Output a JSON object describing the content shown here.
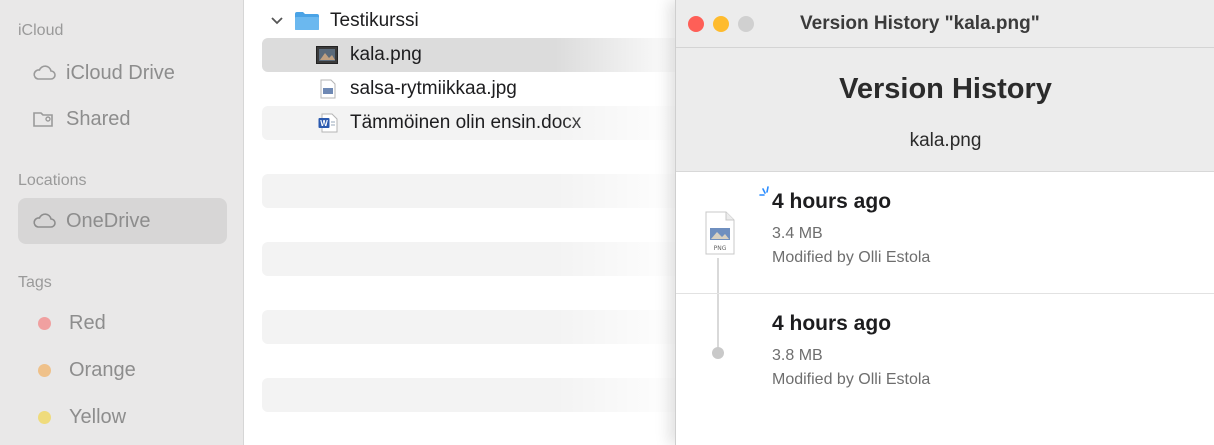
{
  "sidebar": {
    "sections": [
      {
        "heading": "iCloud",
        "items": [
          {
            "label": "iCloud Drive",
            "icon": "cloud-icon"
          },
          {
            "label": "Shared",
            "icon": "shared-folder-icon"
          }
        ]
      },
      {
        "heading": "Locations",
        "items": [
          {
            "label": "OneDrive",
            "icon": "cloud-icon"
          }
        ]
      },
      {
        "heading": "Tags",
        "items": [
          {
            "label": "Red",
            "color": "#f0a0a0"
          },
          {
            "label": "Orange",
            "color": "#efc18a"
          },
          {
            "label": "Yellow",
            "color": "#efdb7c"
          }
        ]
      }
    ]
  },
  "files": {
    "folder": {
      "name": "Testikurssi",
      "icon": "folder-icon",
      "expanded": true
    },
    "items": [
      {
        "name": "kala.png",
        "icon": "image-thumbnail-icon",
        "selected": true
      },
      {
        "name": "salsa-rytmiikkaa.jpg",
        "icon": "jpg-file-icon"
      },
      {
        "name": "Tämmöinen olin ensin.docx",
        "icon": "word-doc-icon"
      }
    ]
  },
  "version_history": {
    "window_title": "Version History \"kala.png\"",
    "heading": "Version History",
    "file_name": "kala.png",
    "versions": [
      {
        "time": "4 hours ago",
        "size": "3.4 MB",
        "modified_by": "Modified by Olli Estola"
      },
      {
        "time": "4 hours ago",
        "size": "3.8 MB",
        "modified_by": "Modified by Olli Estola"
      }
    ],
    "thumb_label": "PNG"
  },
  "colors": {
    "close": "#fe5f57",
    "minimize": "#febb2e",
    "zoom": "#d0d0d0",
    "folder_blue": "#4aa3e6"
  }
}
